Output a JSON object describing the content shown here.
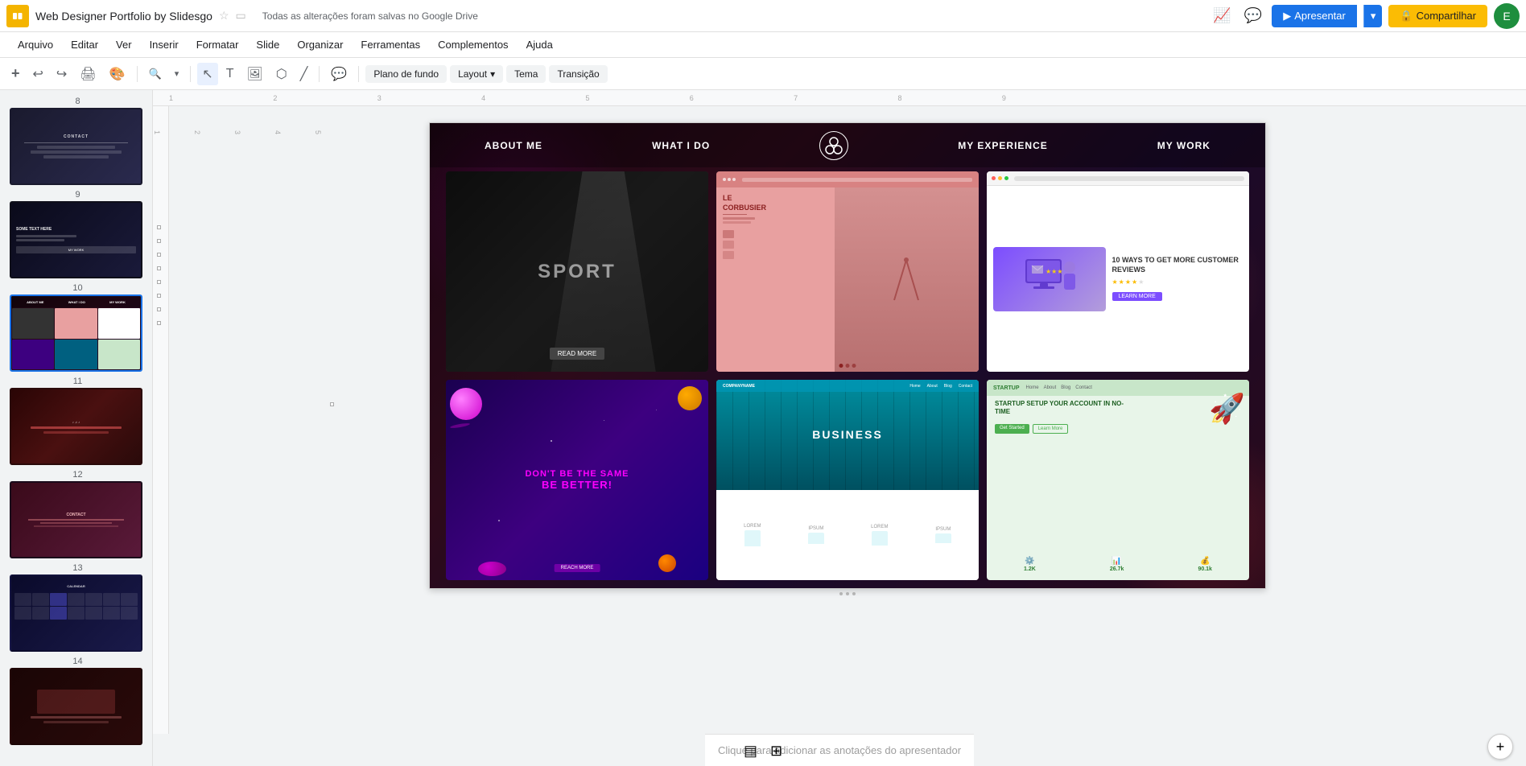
{
  "app": {
    "icon": "G",
    "title": "Web Designer Portfolio by Slidesgo",
    "save_status": "Todas as alterações foram salvas no Google Drive"
  },
  "menu": {
    "items": [
      "Arquivo",
      "Editar",
      "Ver",
      "Inserir",
      "Formatar",
      "Slide",
      "Organizar",
      "Ferramentas",
      "Complementos",
      "Ajuda"
    ]
  },
  "toolbar": {
    "background_label": "Plano de fundo",
    "layout_label": "Layout",
    "theme_label": "Tema",
    "transition_label": "Transição"
  },
  "buttons": {
    "apresentar": "Apresentar",
    "compartilhar": "Compartilhar",
    "lock_icon": "🔒"
  },
  "slide": {
    "nav_items": [
      "ABOUT ME",
      "WHAT I DO",
      "MY EXPERIENCE",
      "MY WORK"
    ],
    "screenshots": [
      {
        "type": "sport",
        "title": "SPORT"
      },
      {
        "type": "lecorbusier",
        "title": "LE CORBUSIER"
      },
      {
        "type": "reviews",
        "title": "10 WAYS TO GET MORE CUSTOMER REVIEWS"
      },
      {
        "type": "space",
        "line1": "DON'T BE THE SAME",
        "line2": "BE BETTER!"
      },
      {
        "type": "business",
        "title": "BUSINESS"
      },
      {
        "type": "startup",
        "title": "STARTUP SETUP YOUR ACCOUNT IN NO-TIME"
      }
    ]
  },
  "sidebar": {
    "slides": [
      {
        "num": "8",
        "type": "dark"
      },
      {
        "num": "9",
        "type": "dark2"
      },
      {
        "num": "10",
        "type": "active"
      },
      {
        "num": "11",
        "type": "red"
      },
      {
        "num": "12",
        "type": "pink"
      },
      {
        "num": "13",
        "type": "grid"
      },
      {
        "num": "14",
        "type": "dark3"
      }
    ]
  },
  "notes": {
    "placeholder": "Clique para adicionar as anotações do apresentador"
  }
}
